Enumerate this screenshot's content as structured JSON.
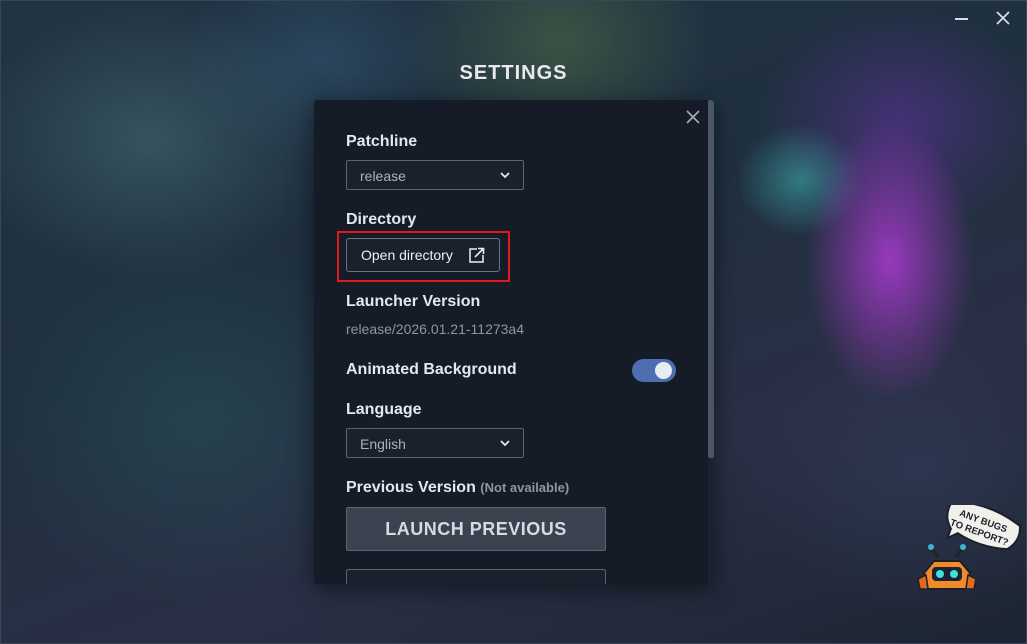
{
  "window": {
    "title": "SETTINGS",
    "minimize_icon": "minimize-icon",
    "close_icon": "close-icon"
  },
  "settings": {
    "patchline": {
      "label": "Patchline",
      "selected": "release"
    },
    "directory": {
      "label": "Directory",
      "button": "Open directory",
      "icon": "external-link-icon"
    },
    "launcher_version": {
      "label": "Launcher Version",
      "value": "release/2026.01.21-11273a4"
    },
    "animated_background": {
      "label": "Animated Background",
      "enabled": true
    },
    "language": {
      "label": "Language",
      "selected": "English"
    },
    "previous_version": {
      "label": "Previous Version",
      "status": "(Not available)",
      "button": "LAUNCH PREVIOUS"
    }
  },
  "bug_report": {
    "text_line1": "ANY BUGS",
    "text_line2": "TO REPORT?"
  },
  "colors": {
    "accent_toggle": "#4d6fb2",
    "highlight": "#e01818",
    "panel_bg": "#151c27"
  }
}
